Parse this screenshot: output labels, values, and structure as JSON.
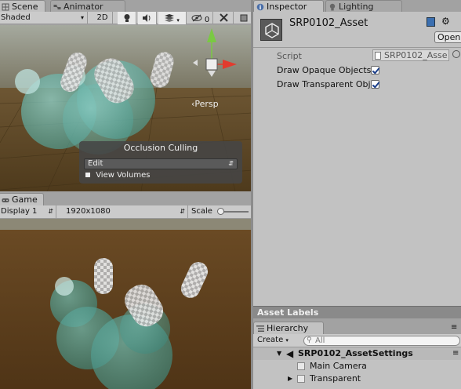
{
  "scene": {
    "tab_scene": "Scene",
    "tab_animator": "Animator",
    "shading_mode": "Shaded",
    "mode_2d": "2D",
    "gizmo_count": "0",
    "persp_label": "‹Persp",
    "occlusion": {
      "title": "Occlusion Culling",
      "mode_value": "Edit",
      "view_volumes_label": "View Volumes"
    }
  },
  "game": {
    "tab_game": "Game",
    "display_value": "Display 1",
    "resolution_value": "1920x1080",
    "scale_label": "Scale"
  },
  "inspector": {
    "tab_inspector": "Inspector",
    "tab_lighting": "Lighting",
    "asset_name": "SRP0102_Asset",
    "open_button": "Open",
    "script_label": "Script",
    "script_value": "SRP0102_Asse",
    "draw_opaque_label": "Draw Opaque Objects",
    "draw_transparent_label": "Draw Transparent Objects",
    "draw_opaque_checked": true,
    "draw_transparent_checked": true,
    "asset_labels_header": "Asset Labels"
  },
  "hierarchy": {
    "tab_hierarchy": "Hierarchy",
    "create_button": "Create",
    "search_placeholder": "All",
    "scene_name": "SRP0102_AssetSettings",
    "items": [
      {
        "label": "Main Camera"
      },
      {
        "label": "Transparent"
      }
    ]
  },
  "colors": {
    "panel_bg": "#c2c2c2",
    "scene_sky": "#8a8a7a",
    "scene_ground": "#5a4322",
    "game_ground": "#5c3f1c",
    "gizmo_y": "#7ac943",
    "gizmo_x": "#e23b2e",
    "gizmo_z": "#4a7ee8"
  }
}
